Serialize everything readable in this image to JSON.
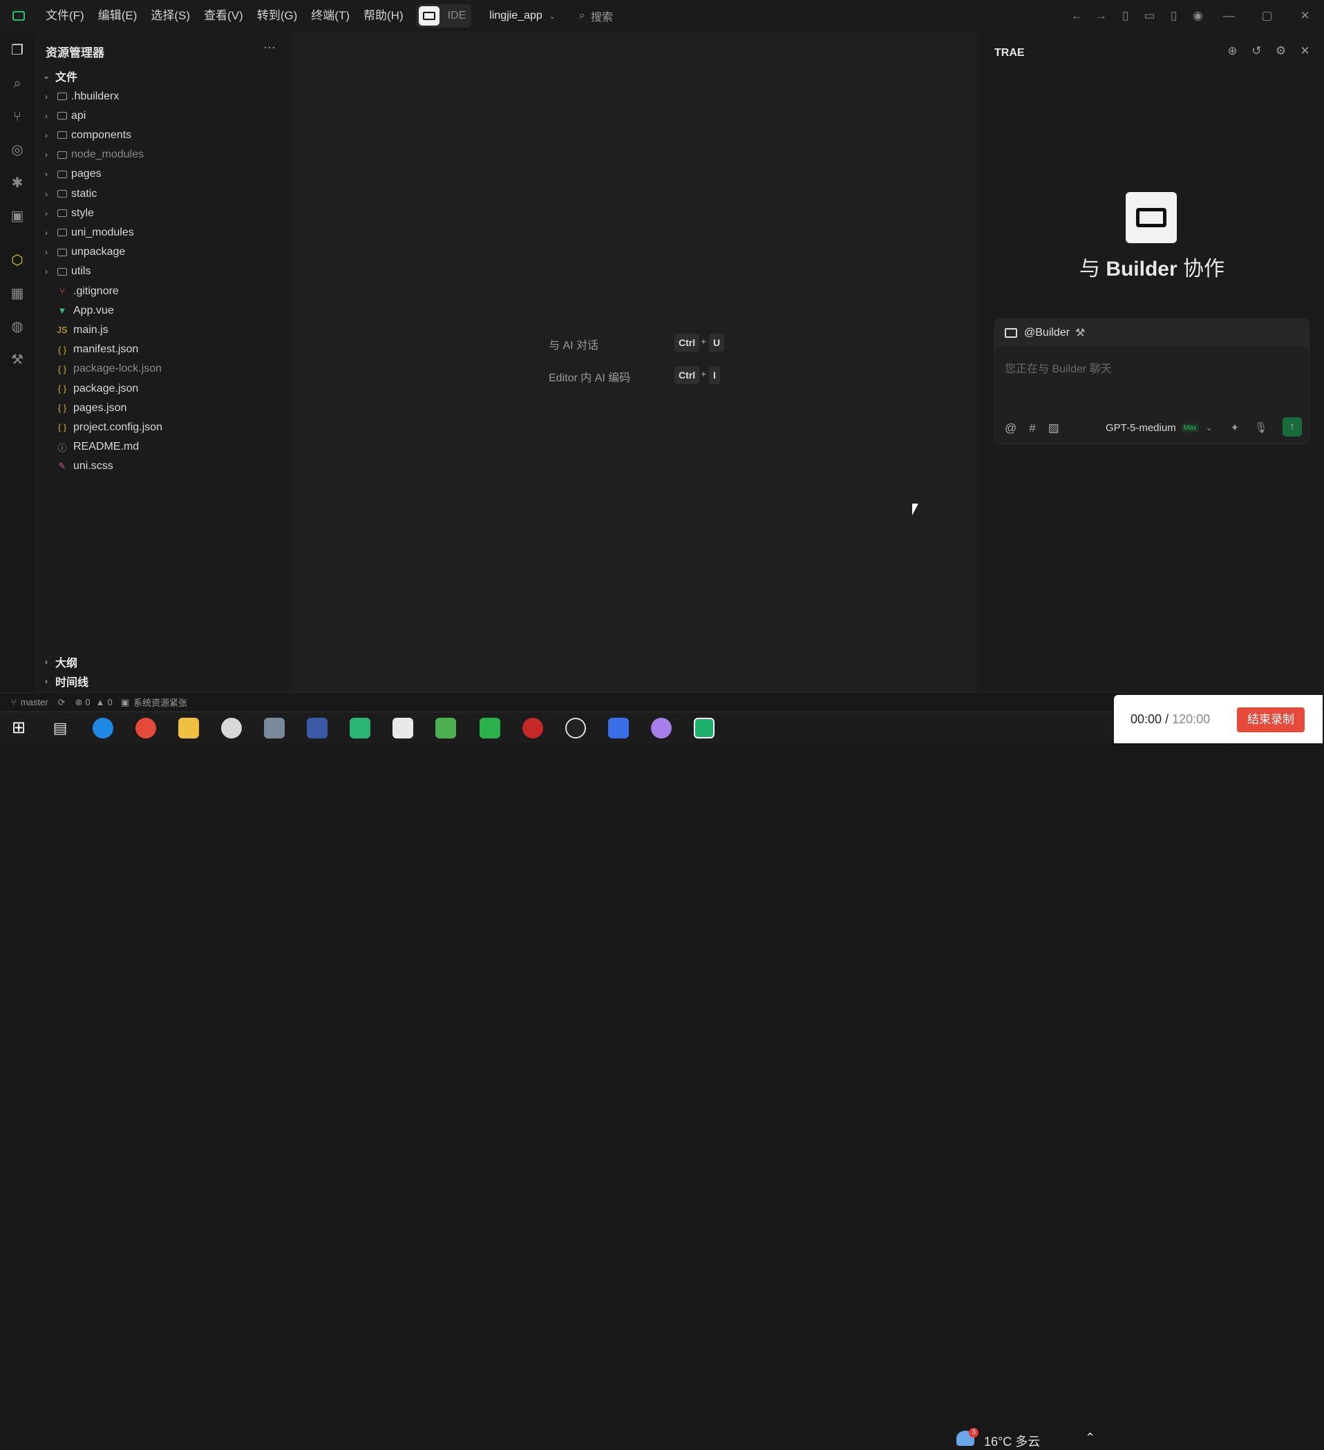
{
  "titlebar": {
    "menus": [
      "文件(F)",
      "编辑(E)",
      "选择(S)",
      "查看(V)",
      "转到(G)",
      "终端(T)",
      "帮助(H)"
    ],
    "ide_label": "IDE",
    "project": "lingjie_app",
    "search_placeholder": "搜索"
  },
  "explorer": {
    "title": "资源管理器",
    "more": "···",
    "section_files": "文件",
    "items": [
      {
        "name": ".hbuilderx",
        "type": "folder"
      },
      {
        "name": "api",
        "type": "folder"
      },
      {
        "name": "components",
        "type": "folder"
      },
      {
        "name": "node_modules",
        "type": "folder",
        "dim": true
      },
      {
        "name": "pages",
        "type": "folder"
      },
      {
        "name": "static",
        "type": "folder"
      },
      {
        "name": "style",
        "type": "folder"
      },
      {
        "name": "uni_modules",
        "type": "folder"
      },
      {
        "name": "unpackage",
        "type": "folder"
      },
      {
        "name": "utils",
        "type": "folder"
      },
      {
        "name": ".gitignore",
        "type": "git"
      },
      {
        "name": "App.vue",
        "type": "vue"
      },
      {
        "name": "main.js",
        "type": "js"
      },
      {
        "name": "manifest.json",
        "type": "json"
      },
      {
        "name": "package-lock.json",
        "type": "json",
        "dim": true
      },
      {
        "name": "package.json",
        "type": "json"
      },
      {
        "name": "pages.json",
        "type": "json"
      },
      {
        "name": "project.config.json",
        "type": "json"
      },
      {
        "name": "README.md",
        "type": "info"
      },
      {
        "name": "uni.scss",
        "type": "scss"
      }
    ],
    "section_outline": "大纲",
    "section_timeline": "时间线"
  },
  "editor": {
    "hint1": "与 AI 对话",
    "hint1_keys": [
      "Ctrl",
      "+",
      "U"
    ],
    "hint2": "Editor 内 AI 编码",
    "hint2_keys": [
      "Ctrl",
      "+",
      "I"
    ]
  },
  "trae": {
    "title": "TRAE",
    "collab_prefix": "与",
    "collab_name": "Builder",
    "collab_suffix": "协作",
    "mention": "@Builder",
    "placeholder": "您正在与 Builder 聊天",
    "model": "GPT-5-medium",
    "model_badge": "Max"
  },
  "statusbar": {
    "branch": "master",
    "errors": "0",
    "warnings": "0",
    "resource_text": "系统资源紧张"
  },
  "taskbar": {
    "weather": "16°C 多云",
    "weather_badge": "3"
  },
  "recording": {
    "elapsed": "00:00",
    "separator": "/",
    "total": "120:00",
    "stop_label": "结束录制"
  },
  "colors": {
    "accent_green": "#23c26b",
    "record_red": "#e54a3a"
  }
}
